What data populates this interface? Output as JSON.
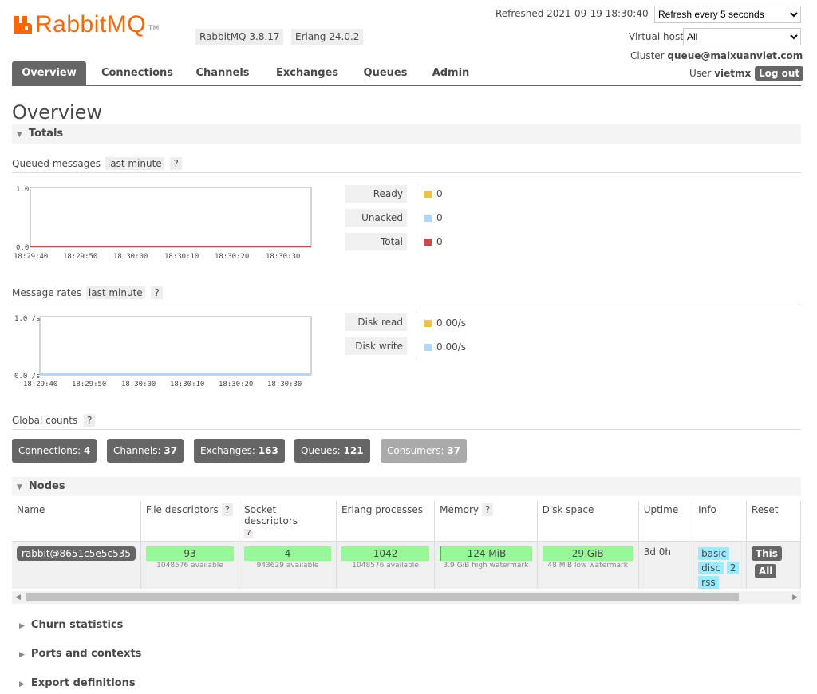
{
  "header": {
    "logo_rabbit": "Rabbit",
    "logo_mq": "MQ",
    "logo_tm": "TM",
    "version": "RabbitMQ 3.8.17",
    "erlang": "Erlang 24.0.2",
    "refreshed": "Refreshed 2021-09-19 18:30:40",
    "refresh_option": "Refresh every 5 seconds",
    "vhost_label": "Virtual host",
    "vhost_value": "All",
    "cluster_label": "Cluster",
    "cluster_name": "queue@maixuanviet.com",
    "user_label": "User",
    "user_name": "vietmx",
    "logout": "Log out"
  },
  "tabs": [
    "Overview",
    "Connections",
    "Channels",
    "Exchanges",
    "Queues",
    "Admin"
  ],
  "page_title": "Overview",
  "totals": {
    "section": "Totals",
    "queued": {
      "label": "Queued messages",
      "range": "last minute",
      "help": "?",
      "y_top": "1.0",
      "y_bottom": "0.0",
      "x_ticks": [
        "18:29:40",
        "18:29:50",
        "18:30:00",
        "18:30:10",
        "18:30:20",
        "18:30:30"
      ],
      "legend": [
        {
          "label": "Ready",
          "value": "0",
          "color": "#edc240"
        },
        {
          "label": "Unacked",
          "value": "0",
          "color": "#afd8f8"
        },
        {
          "label": "Total",
          "value": "0",
          "color": "#cb4b4b"
        }
      ]
    },
    "rates": {
      "label": "Message rates",
      "range": "last minute",
      "help": "?",
      "y_top": "1.0 /s",
      "y_bottom": "0.0 /s",
      "x_ticks": [
        "18:29:40",
        "18:29:50",
        "18:30:00",
        "18:30:10",
        "18:30:20",
        "18:30:30"
      ],
      "legend": [
        {
          "label": "Disk read",
          "value": "0.00/s",
          "color": "#edc240"
        },
        {
          "label": "Disk write",
          "value": "0.00/s",
          "color": "#afd8f8"
        }
      ]
    },
    "global_counts": {
      "label": "Global counts",
      "help": "?",
      "items": [
        {
          "label": "Connections:",
          "value": "4"
        },
        {
          "label": "Channels:",
          "value": "37"
        },
        {
          "label": "Exchanges:",
          "value": "163"
        },
        {
          "label": "Queues:",
          "value": "121"
        },
        {
          "label": "Consumers:",
          "value": "37"
        }
      ]
    }
  },
  "nodes": {
    "section": "Nodes",
    "columns": [
      "Name",
      "File descriptors",
      "Socket descriptors",
      "Erlang processes",
      "Memory",
      "Disk space",
      "Uptime",
      "Info",
      "Reset"
    ],
    "help": "?",
    "row": {
      "name": "rabbit@8651c5e5c535",
      "fd": "93",
      "fd_sub": "1048576 available",
      "sd": "4",
      "sd_sub": "943629 available",
      "ep": "1042",
      "ep_sub": "1048576 available",
      "mem": "124 MiB",
      "mem_sub": "3.9 GiB high watermark",
      "disk": "29 GiB",
      "disk_sub": "48 MiB low watermark",
      "uptime": "3d 0h",
      "info": [
        "basic",
        "disc",
        "2",
        "rss"
      ],
      "reset": [
        "This",
        "All"
      ]
    }
  },
  "collapsed": [
    "Churn statistics",
    "Ports and contexts",
    "Export definitions"
  ]
}
